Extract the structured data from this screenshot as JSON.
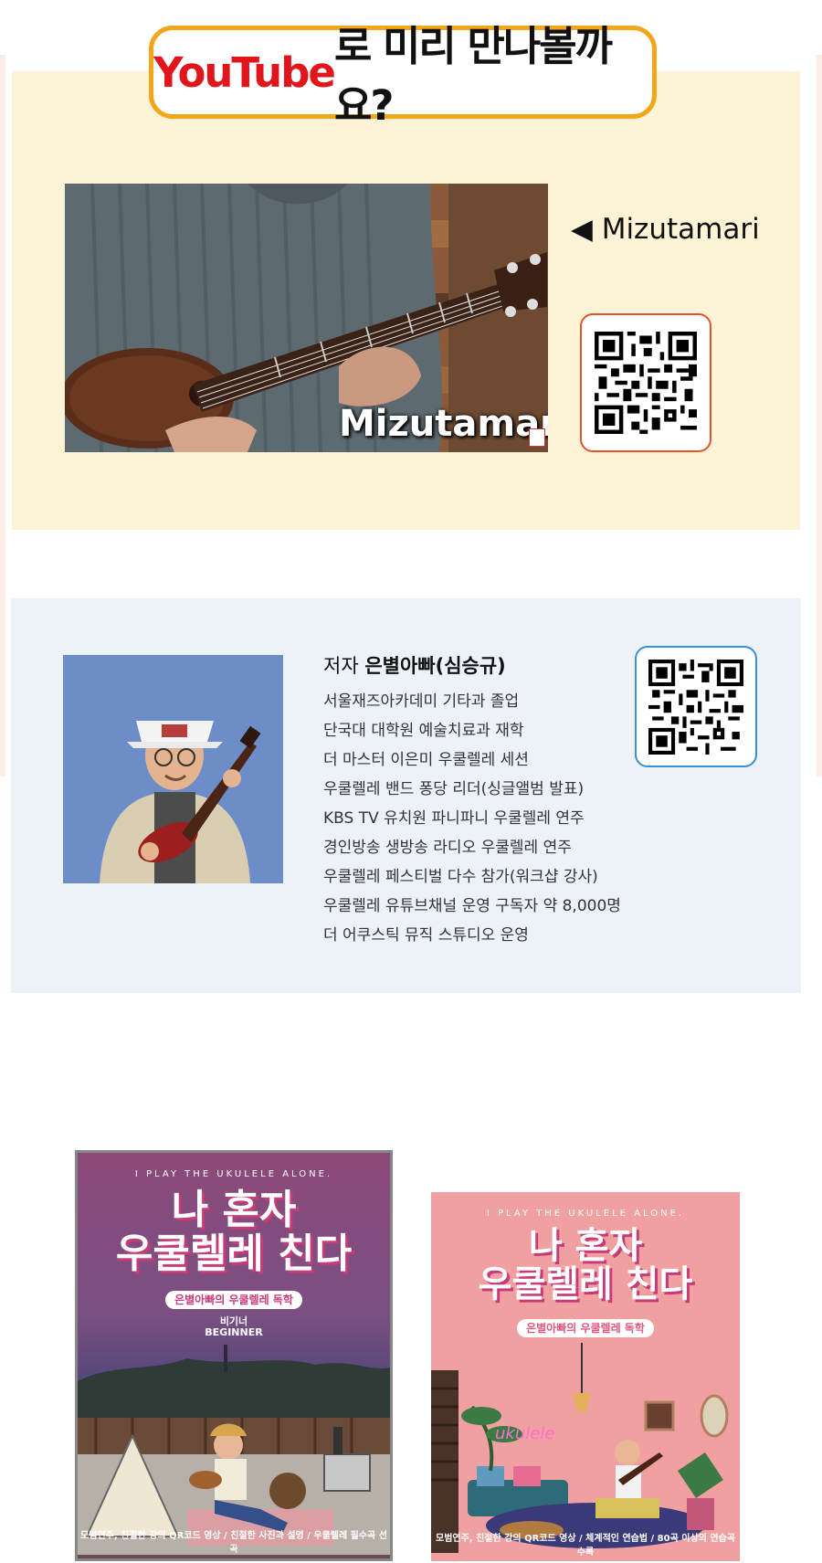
{
  "youtube_section": {
    "heading_brand": "YouTube",
    "heading_text": "로 미리 만나볼까요?",
    "channel_label": "◀ Mizutamari",
    "video_caption": "Mizutamari"
  },
  "author_section": {
    "name_prefix": "저자",
    "name": "은별아빠(심승규)",
    "bio": [
      "서울재즈아카데미 기타과 졸업",
      "단국대 대학원 예술치료과 재학",
      "더 마스터 이은미 우쿨렐레 세션",
      "우쿨렐레 밴드 퐁당 리더(싱글앨범 발표)",
      "KBS TV 유치원 파니파니 우쿨렐레 연주",
      "경인방송 생방송 라디오 우쿨렐레 연주",
      "우쿨렐레 페스티벌 다수 참가(워크샵 강사)",
      "우쿨렐레 유튜브채널 운영 구독자 약 8,000명",
      "더 어쿠스틱 뮤직 스튜디오 운영"
    ]
  },
  "books": [
    {
      "tagline": "I PLAY THE UKULELE ALONE.",
      "title_line1": "나 혼자",
      "title_line2": "우쿨렐레 친다",
      "subtitle": "은별아빠의 우쿨렐레 독학",
      "level_ko": "비기너",
      "level_en": "BEGINNER",
      "footer": "모범연주, 친절한 강의 QR코드 영상 / 친절한 사진과 설명 / 우쿨렐레 필수곡 선곡"
    },
    {
      "tagline": "I PLAY THE UKULELE ALONE.",
      "title_line1": "나 혼자",
      "title_line2": "우쿨렐레 친다",
      "subtitle": "은별아빠의 우쿨렐레 독학",
      "neon": "ukulele",
      "footer": "모범연주, 친절한 강의 QR코드 영상 / 체계적인 연습법 / 80곡 이상의 연습곡 수록"
    }
  ],
  "colors": {
    "youtube_red": "#e1161c",
    "badge_border": "#f2a61a",
    "yt_bg": "#fdf3d6",
    "author_bg": "#edf1f8",
    "qr1_border": "#e0552a",
    "qr2_border": "#3a8fd6"
  }
}
